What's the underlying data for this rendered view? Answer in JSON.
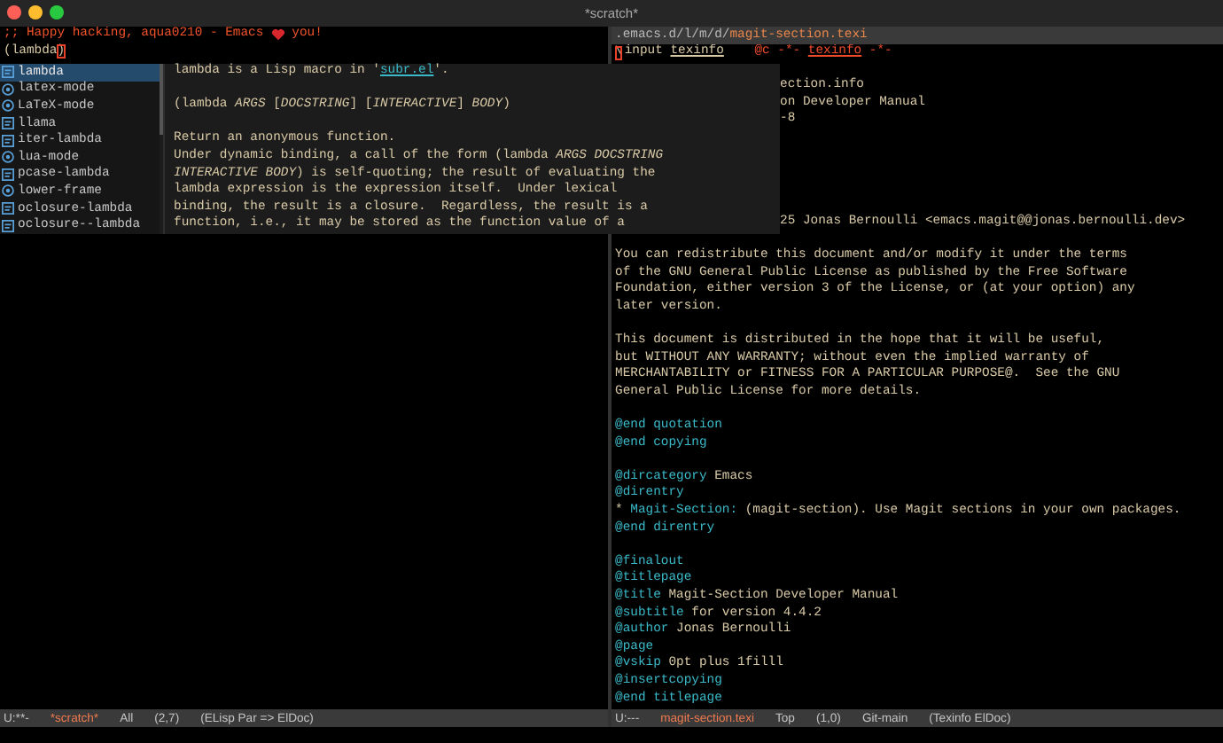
{
  "window": {
    "title": "*scratch*"
  },
  "left_pane": {
    "greeting": {
      "before_icon": ";; Happy hacking, aqua0210 - Emacs",
      "after_icon": "you!"
    },
    "input_line": {
      "text": "(lambda",
      "cursor_char": ")"
    },
    "mode_line": {
      "state": "U:**-",
      "buffer": "*scratch*",
      "position": "All",
      "cursor": "(2,7)",
      "modes": "(ELisp Par => ElDoc)"
    }
  },
  "completion": {
    "candidates": [
      {
        "label": "lambda",
        "kind": "macro",
        "selected": true
      },
      {
        "label": "latex-mode",
        "kind": "command",
        "selected": false
      },
      {
        "label": "LaTeX-mode",
        "kind": "command",
        "selected": false
      },
      {
        "label": "llama",
        "kind": "macro",
        "selected": false
      },
      {
        "label": "iter-lambda",
        "kind": "macro",
        "selected": false
      },
      {
        "label": "lua-mode",
        "kind": "command",
        "selected": false
      },
      {
        "label": "pcase-lambda",
        "kind": "macro",
        "selected": false
      },
      {
        "label": "lower-frame",
        "kind": "command",
        "selected": false
      },
      {
        "label": "oclosure-lambda",
        "kind": "macro",
        "selected": false
      },
      {
        "label": "oclosure--lambda",
        "kind": "macro",
        "selected": false
      }
    ],
    "doc": {
      "summary_before": "lambda is a Lisp macro in '",
      "link": "subr.el",
      "summary_after": "'.",
      "signature": "(lambda *ARGS* [*DOCSTRING*] [*INTERACTIVE*] *BODY*)",
      "paragraph": [
        "Return an anonymous function.",
        "Under dynamic binding, a call of the form (lambda *ARGS DOCSTRING*",
        "*INTERACTIVE BODY*) is self-quoting; the result of evaluating the",
        "lambda expression is the expression itself.  Under lexical",
        "binding, the result is a closure.  Regardless, the result is a",
        "function, i.e., it may be stored as the function value of a"
      ]
    }
  },
  "right_pane": {
    "header": {
      "path": ".emacs.d/l/m/d/",
      "file": "magit-section.texi"
    },
    "first_line": {
      "cursor_char": "\\",
      "command": "input",
      "arg": "texinfo",
      "comment": "@c -*- ",
      "mode": "texinfo",
      "comment_end": " -*-"
    },
    "lines": [
      {
        "kind": "blank"
      },
      {
        "kind": "covered",
        "text": "ection.info"
      },
      {
        "kind": "covered",
        "text": "on Developer Manual"
      },
      {
        "kind": "covered",
        "text": "-8"
      },
      {
        "kind": "blank"
      },
      {
        "kind": "blank"
      },
      {
        "kind": "blank"
      },
      {
        "kind": "blank"
      },
      {
        "kind": "blank"
      },
      {
        "kind": "covered",
        "text": "25 Jonas Bernoulli <emacs.magit@@jonas.bernoulli.dev>"
      },
      {
        "kind": "blank"
      },
      {
        "kind": "text",
        "text": "You can redistribute this document and/or modify it under the terms"
      },
      {
        "kind": "text",
        "text": "of the GNU General Public License as published by the Free Software"
      },
      {
        "kind": "text",
        "text": "Foundation, either version 3 of the License, or (at your option) any"
      },
      {
        "kind": "text",
        "text": "later version."
      },
      {
        "kind": "blank"
      },
      {
        "kind": "text",
        "text": "This document is distributed in the hope that it will be useful,"
      },
      {
        "kind": "text",
        "text": "but WITHOUT ANY WARRANTY; without even the implied warranty of"
      },
      {
        "kind": "text",
        "text": "MERCHANTABILITY or FITNESS FOR A PARTICULAR PURPOSE@.  See the GNU"
      },
      {
        "kind": "text",
        "text": "General Public License for more details."
      },
      {
        "kind": "blank"
      },
      {
        "kind": "command",
        "command": "@end quotation"
      },
      {
        "kind": "command",
        "command": "@end copying"
      },
      {
        "kind": "blank"
      },
      {
        "kind": "command",
        "command": "@dircategory",
        "rest": " Emacs"
      },
      {
        "kind": "command",
        "command": "@direntry"
      },
      {
        "kind": "entry",
        "bullet": "* ",
        "name": "Magit-Section:",
        "rest": " (magit-section). Use Magit sections in your own packages."
      },
      {
        "kind": "command",
        "command": "@end direntry"
      },
      {
        "kind": "blank"
      },
      {
        "kind": "command",
        "command": "@finalout"
      },
      {
        "kind": "command",
        "command": "@titlepage"
      },
      {
        "kind": "command",
        "command": "@title",
        "rest": " Magit-Section Developer Manual"
      },
      {
        "kind": "command",
        "command": "@subtitle",
        "rest": " for version 4.4.2"
      },
      {
        "kind": "command",
        "command": "@author",
        "rest": " Jonas Bernoulli"
      },
      {
        "kind": "command",
        "command": "@page"
      },
      {
        "kind": "command",
        "command": "@vskip",
        "rest": " 0pt plus 1filll"
      },
      {
        "kind": "command",
        "command": "@insertcopying"
      },
      {
        "kind": "command",
        "command": "@end titlepage"
      }
    ],
    "mode_line": {
      "state": "U:---",
      "buffer": "magit-section.texi",
      "position": "Top",
      "cursor": "(1,0)",
      "vc": "Git-main",
      "modes": "(Texinfo ElDoc)"
    }
  }
}
